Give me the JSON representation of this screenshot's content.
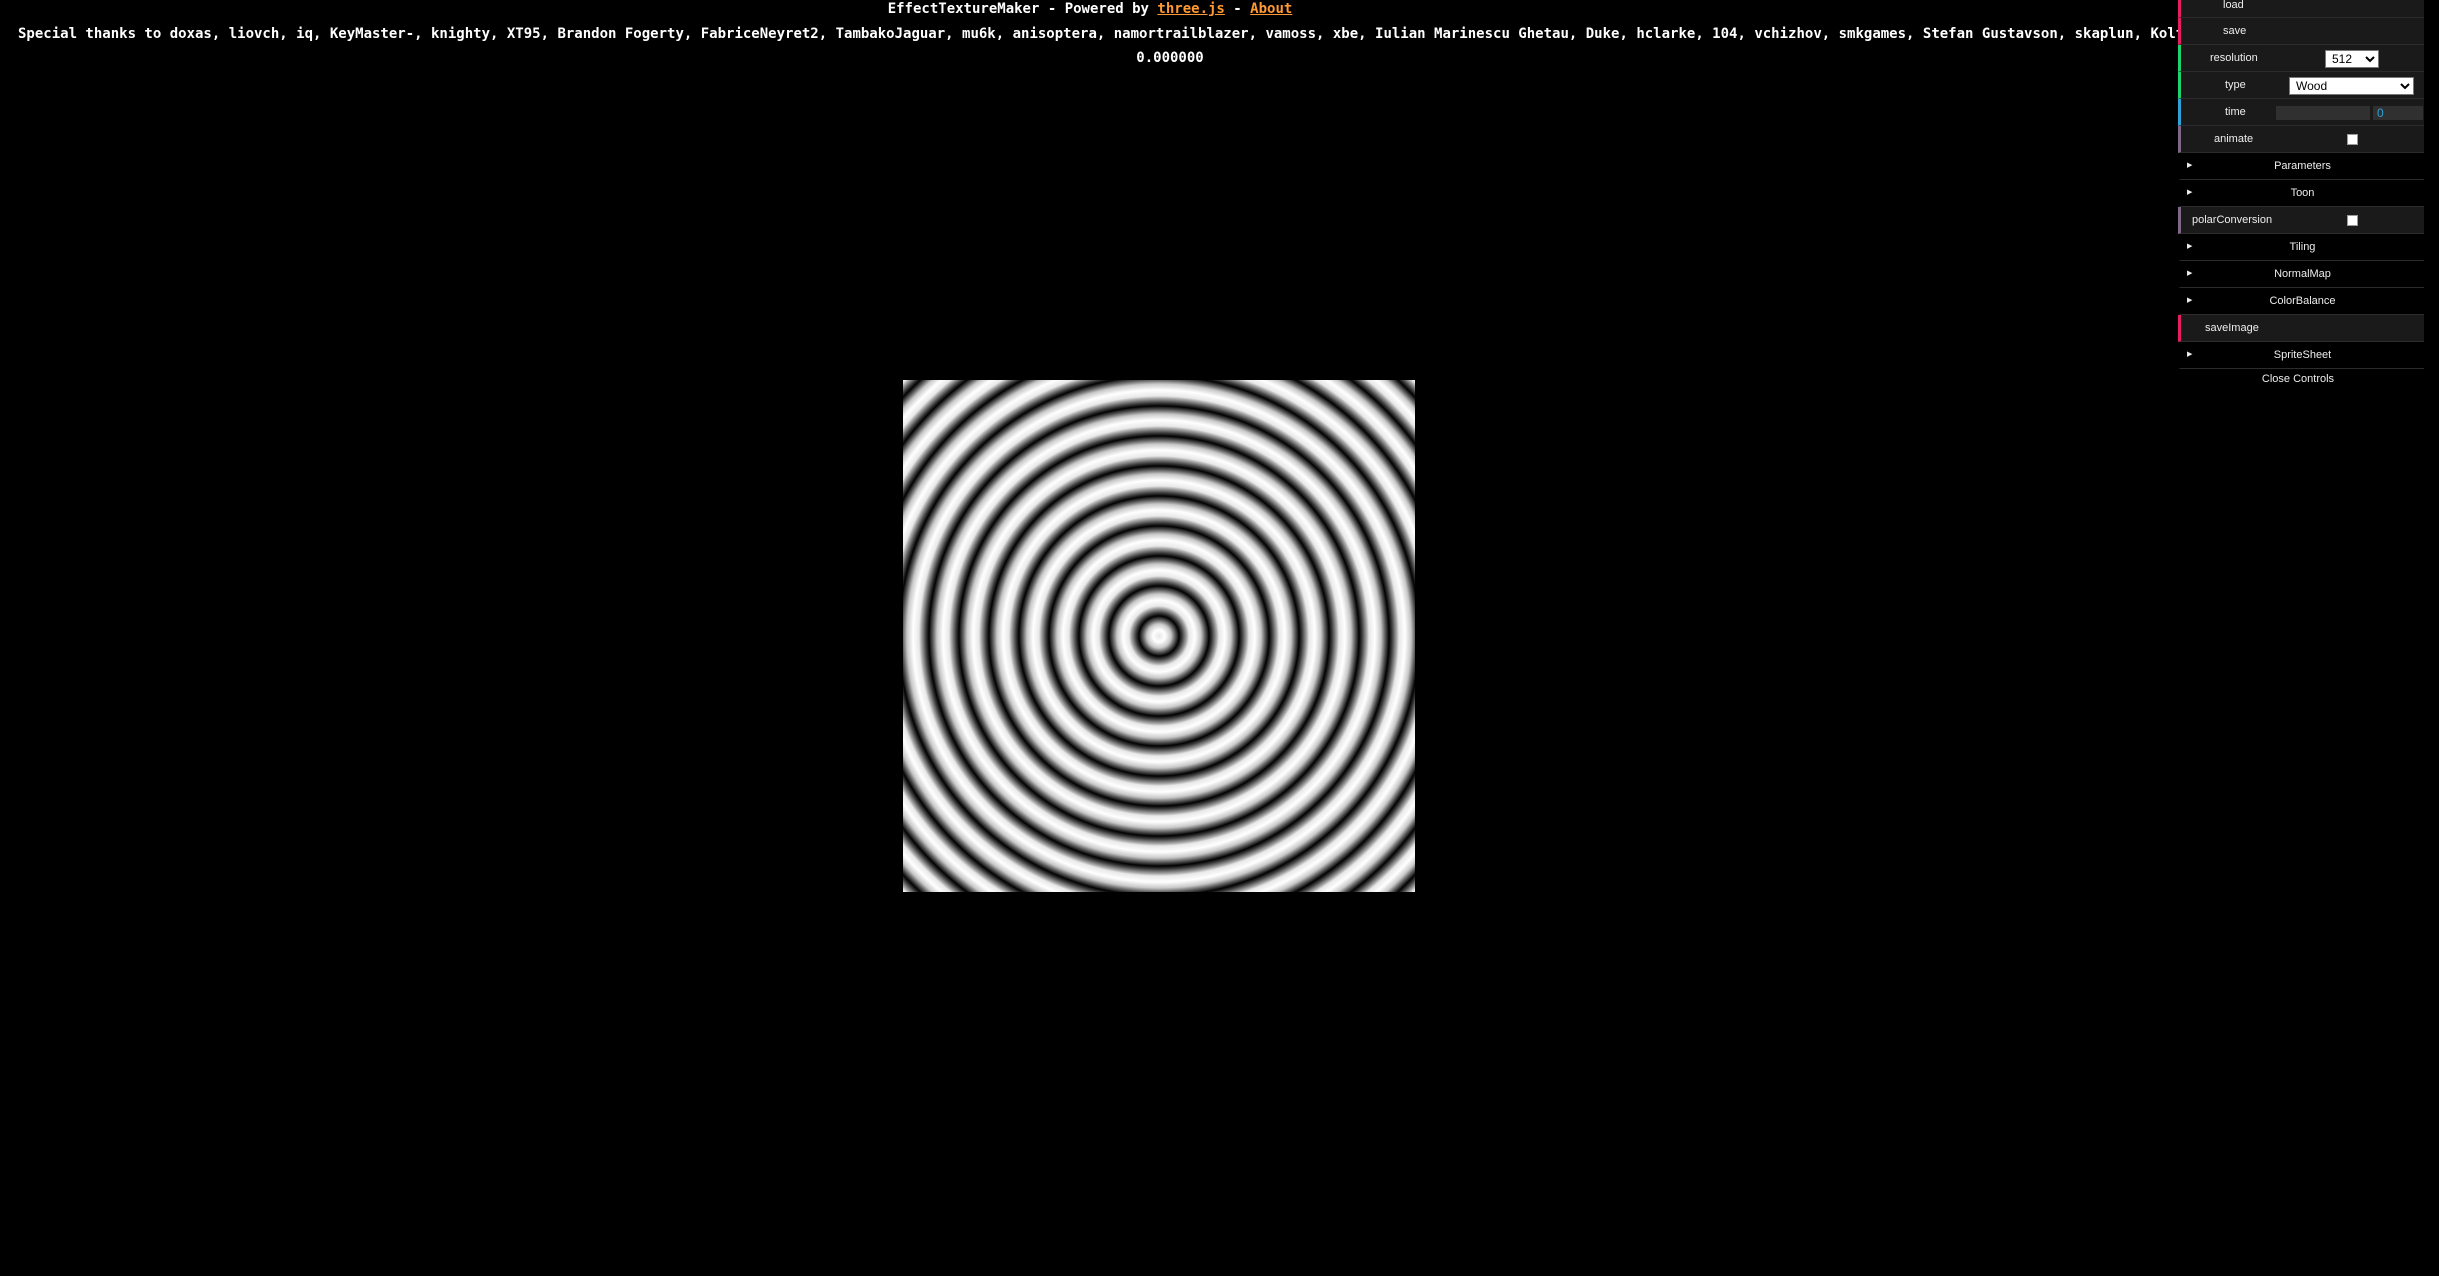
{
  "header": {
    "app_title": "EffectTextureMaker",
    "powered_by": " - Powered by ",
    "threejs_link": "three.js",
    "separator": " - ",
    "about_link": "About",
    "thanks": "Special thanks to doxas, liovch, iq, KeyMaster-, knighty, XT95, Brandon Fogerty, FabriceNeyret2, TambakoJaguar, mu6k, anisoptera, namortrailblazer, vamoss, xbe, Iulian Marinescu Ghetau, Duke, hclarke, 104, vchizhov, smkgames, Stefan Gustavson, skaplun, Koltes, arxyz, diviaki, Sunpy, Hadyn, Dave_Hoskins",
    "timer": "0.000000"
  },
  "gui": {
    "load_label": "load",
    "save_label": "save",
    "resolution_label": "resolution",
    "resolution_value": "512",
    "type_label": "type",
    "type_value": "Wood",
    "time_label": "time",
    "time_value": "0",
    "animate_label": "animate",
    "folders": {
      "parameters": "Parameters",
      "toon": "Toon",
      "tiling": "Tiling",
      "normalmap": "NormalMap",
      "colorbalance": "ColorBalance",
      "spritesheet": "SpriteSheet"
    },
    "polar_label": "polarConversion",
    "saveimage_label": "saveImage",
    "close_label": "Close Controls"
  },
  "colors": {
    "function_accent": "#e61d5f",
    "number_accent": "#2fa1d6",
    "boolean_accent": "#806787",
    "option_accent": "#1ed36f",
    "link": "#ff9933"
  }
}
